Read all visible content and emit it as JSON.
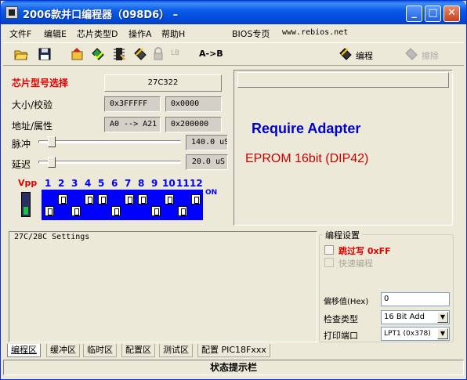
{
  "window": {
    "title": "2006款并口编程器（098D6）  –",
    "controls": {
      "minimize": "_",
      "maximize": "□",
      "close": "✕"
    }
  },
  "menu": {
    "items": [
      "文件F",
      "编辑E",
      "芯片类型D",
      "操作A",
      "帮助H"
    ],
    "bios_label": "BIOS专页",
    "website": "www.rebios.net"
  },
  "toolbar": {
    "icons": [
      "open-folder-icon",
      "save-disk-icon",
      "read-chip-icon",
      "verify-icon",
      "blank-check-icon",
      "auto-icon",
      "lock-icon",
      "lb-icon"
    ],
    "lb_label": "LB",
    "ab_label": "A->B",
    "program_label": "编程",
    "erase_label": "擦除"
  },
  "chip": {
    "select_label": "芯片型号选择",
    "model": "27C322",
    "size_label": "大小/校验",
    "size": "0x3FFFFF",
    "checksum": "0x0000",
    "addr_label": "地址/属性",
    "addr_range": "A0 --> A21",
    "attr": "0x200000",
    "pulse_label": "脉冲",
    "pulse_value": "140.0 uS",
    "delay_label": "延迟",
    "delay_value": "20.0 uS",
    "vpp_label": "Vpp",
    "dip_numbers": [
      "1",
      "2",
      "3",
      "4",
      "5",
      "6",
      "7",
      "8",
      "9",
      "10",
      "11",
      "12"
    ],
    "on_label": "ON"
  },
  "adapter": {
    "title": "Require Adapter",
    "desc": "EPROM 16bit (DIP42)",
    "title_color": "#0000cc",
    "desc_color": "#cc0000"
  },
  "settings": {
    "heading": "27C/28C Settings"
  },
  "program_settings": {
    "heading": "编程设置",
    "skip_label": "跳过写 0xFF",
    "fast_label": "快速编程",
    "offset_label": "偏移值(Hex)",
    "offset_value": "0",
    "check_label": "检查类型",
    "check_value": "16 Bit Add",
    "port_label": "打印端口",
    "port_value": "LPT1 (0x378)"
  },
  "tabs": [
    "编程区",
    "缓冲区",
    "临时区",
    "配置区",
    "测试区",
    "配置 PIC18Fxxx"
  ],
  "status": "状态提示栏"
}
